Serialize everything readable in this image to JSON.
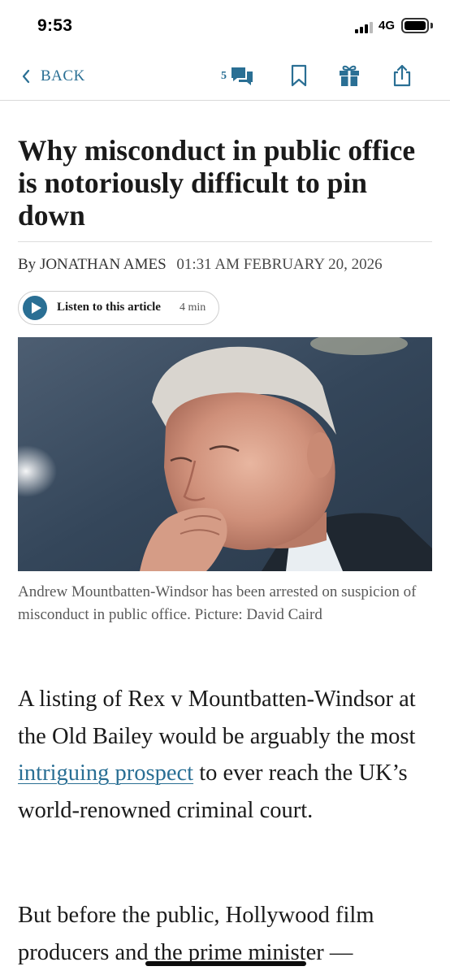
{
  "status_bar": {
    "time": "9:53",
    "network": "4G"
  },
  "toolbar": {
    "back_label": "BACK",
    "comments_count": "5"
  },
  "article": {
    "headline": "Why misconduct in public office is notoriously difficult to pin down",
    "byline_prefix": "By",
    "author": "JONATHAN AMES",
    "date": "01:31 AM FEBRUARY 20, 2026",
    "listen_label": "Listen to this article",
    "listen_duration": "4 min",
    "caption": "Andrew Mountbatten-Windsor has been arrested on suspicion of misconduct in public office. Picture: David Caird",
    "para1_before_link": "A listing of Rex v Mountbatten-Windsor at the Old Bailey would be arguably the most ",
    "para1_link": "intriguing prospect",
    "para1_after_link": " to ever reach the UK’s world-renowned criminal court.",
    "para2": "But before the public, Hollywood film producers and the prime minister —"
  },
  "colors": {
    "accent": "#2a6f94",
    "text": "#1a1a1a",
    "caption": "#595959"
  },
  "icons": [
    "chevron-left-icon",
    "comments-icon",
    "bookmark-icon",
    "gift-icon",
    "share-icon"
  ]
}
